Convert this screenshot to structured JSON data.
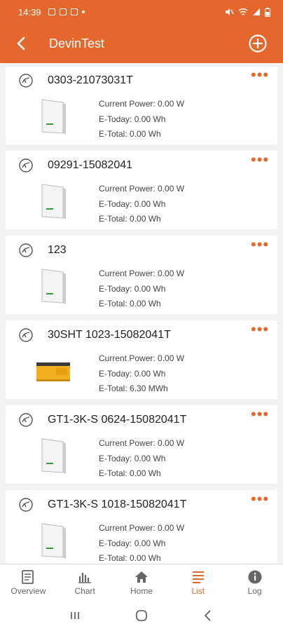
{
  "status_bar": {
    "time": "14:39"
  },
  "header": {
    "title": "DevinTest"
  },
  "devices": [
    {
      "name": "0303-21073031T",
      "current_power": "Current Power: 0.00 W",
      "e_today": "E-Today: 0.00 Wh",
      "e_total": "E-Total: 0.00 Wh",
      "image": "inverter-white"
    },
    {
      "name": "09291-15082041",
      "current_power": "Current Power: 0.00 W",
      "e_today": "E-Today: 0.00 Wh",
      "e_total": "E-Total: 0.00 Wh",
      "image": "inverter-white"
    },
    {
      "name": "123",
      "current_power": "Current Power: 0.00 W",
      "e_today": "E-Today: 0.00 Wh",
      "e_total": "E-Total: 0.00 Wh",
      "image": "inverter-white"
    },
    {
      "name": "30SHT 1023-15082041T",
      "current_power": "Current Power: 0.00 W",
      "e_today": "E-Today: 0.00 Wh",
      "e_total": "E-Total: 6.30 MWh",
      "image": "inverter-yellow"
    },
    {
      "name": "GT1-3K-S 0624-15082041T",
      "current_power": "Current Power: 0.00 W",
      "e_today": "E-Today: 0.00 Wh",
      "e_total": "E-Total: 0.00 Wh",
      "image": "inverter-white"
    },
    {
      "name": "GT1-3K-S 1018-15082041T",
      "current_power": "Current Power: 0.00 W",
      "e_today": "E-Today: 0.00 Wh",
      "e_total": "E-Total: 0.00 Wh",
      "image": "inverter-white"
    }
  ],
  "more_label": "•••",
  "bottom_nav": [
    {
      "label": "Overview",
      "icon": "overview-icon"
    },
    {
      "label": "Chart",
      "icon": "chart-icon"
    },
    {
      "label": "Home",
      "icon": "home-icon"
    },
    {
      "label": "List",
      "icon": "list-icon",
      "active": true
    },
    {
      "label": "Log",
      "icon": "info-icon"
    }
  ],
  "colors": {
    "accent": "#e5672d",
    "background": "#f2f2f2"
  }
}
